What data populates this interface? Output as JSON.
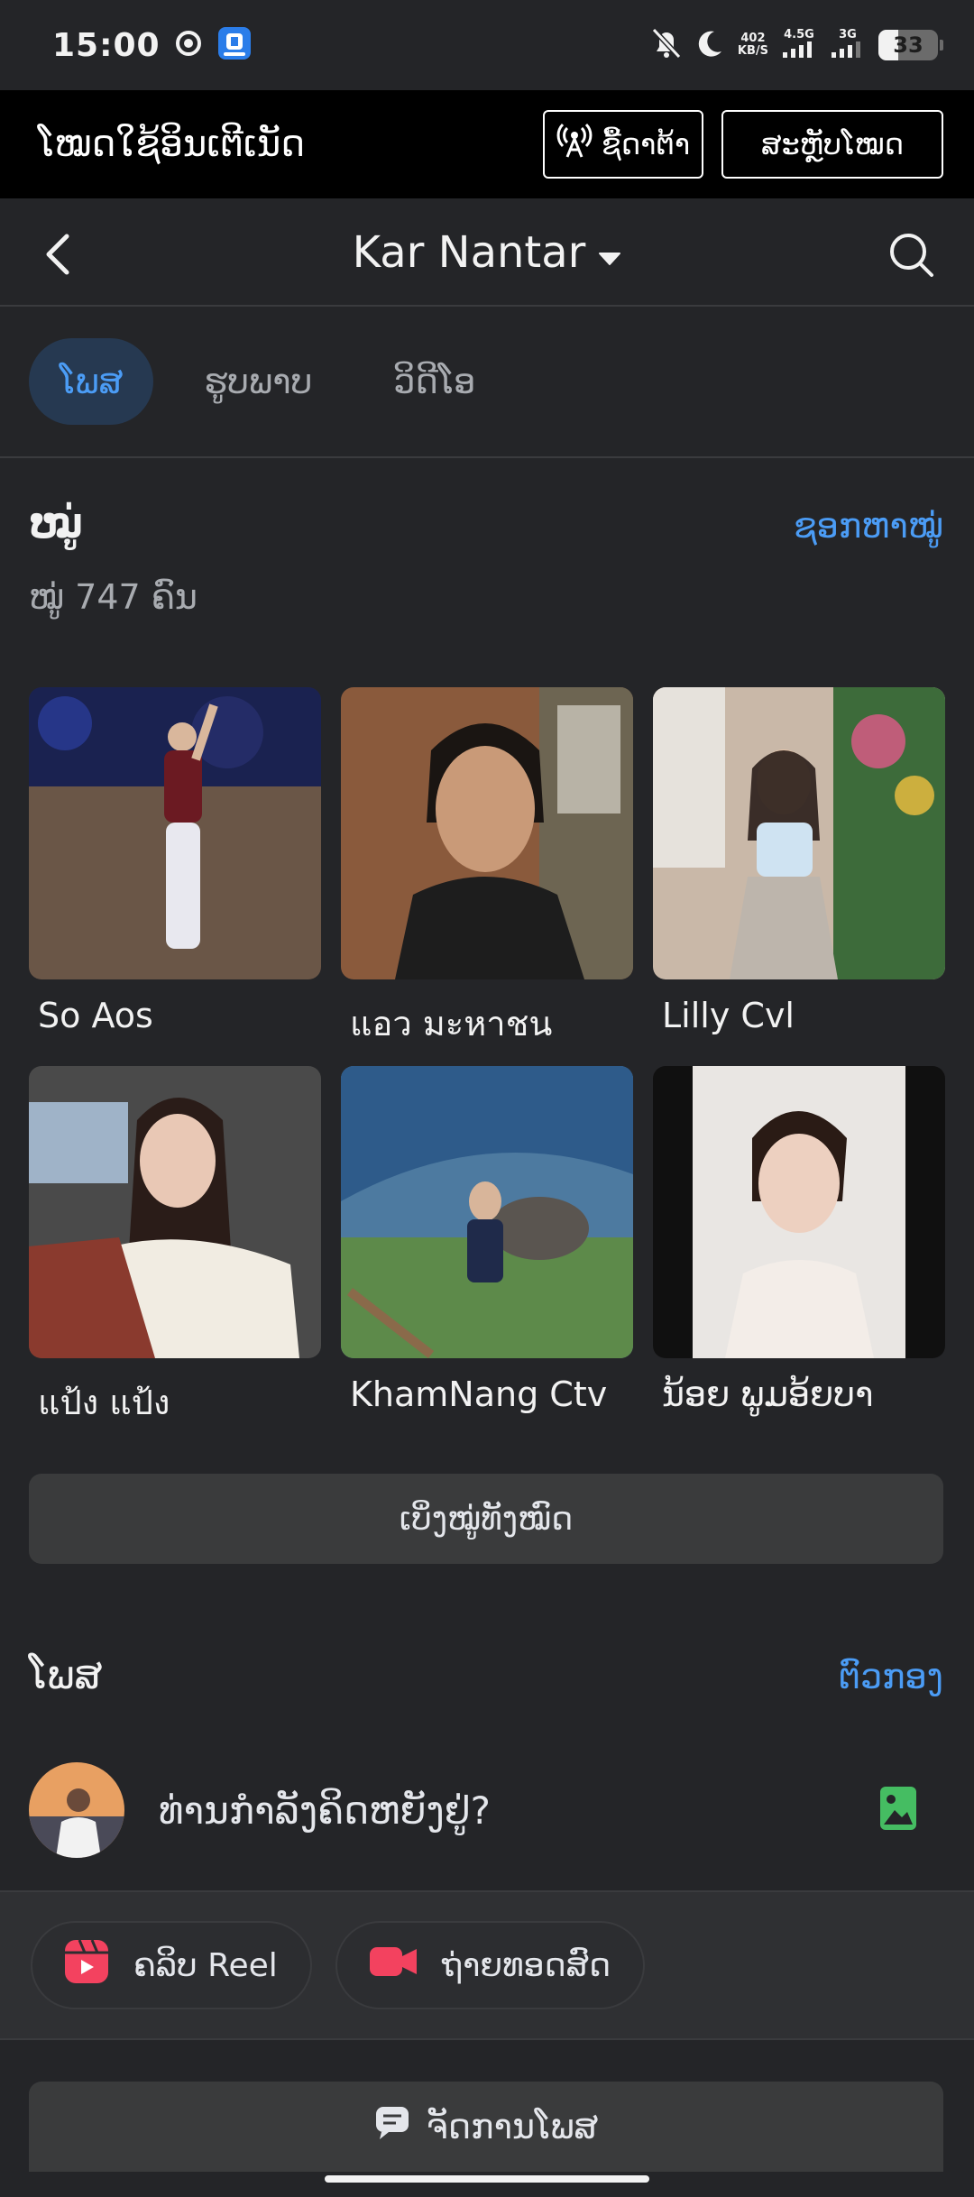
{
  "status_bar": {
    "time": "15:00",
    "speed_value": "402",
    "speed_unit": "KB/S",
    "net1": "4.5G",
    "net2": "3G",
    "battery": "33",
    "battery_level": 0.33
  },
  "data_mode": {
    "title": "ໂໝດໃຊ້ອິນເຕີເນັດ",
    "buy_label": "ຊື້ດາຕ້າ",
    "switch_label": "ສະຫຼັບໂໝດ"
  },
  "header": {
    "title": "Kar Nantar"
  },
  "tabs": [
    {
      "label": "ໂພສ",
      "active": true
    },
    {
      "label": "ຮູບພາບ",
      "active": false
    },
    {
      "label": "ວິດີໂອ",
      "active": false
    }
  ],
  "friends": {
    "title": "ໝູ່",
    "find_link": "ຊອກຫາໝູ່",
    "count_text": "ໝູ່ 747 ຄົນ",
    "items": [
      {
        "name": "So Aos"
      },
      {
        "name": "แอว มะหาชน"
      },
      {
        "name": "Lilly Cvl"
      },
      {
        "name": "แป้ง แป้ง"
      },
      {
        "name": "KhamNang Ctv"
      },
      {
        "name": "ນ້ອຍ ພູມອ້ຍບາ"
      }
    ],
    "see_all": "ເບິ່ງໝູ່ທັງໝົດ"
  },
  "posts": {
    "title": "ໂພສ",
    "filter_link": "ຕົວກອງ",
    "composer_placeholder": "ທ່ານກຳລັງຄິດຫຍັງຢູ່?",
    "reel_label": "ຄລິບ Reel",
    "live_label": "ຖ່າຍທອດສົດ",
    "manage_label": "ຈັດການໂພສ"
  },
  "colors": {
    "background": "#242528",
    "accent": "#4b9cf5",
    "reel_red": "#f3425f",
    "photo_green": "#45bd62"
  }
}
